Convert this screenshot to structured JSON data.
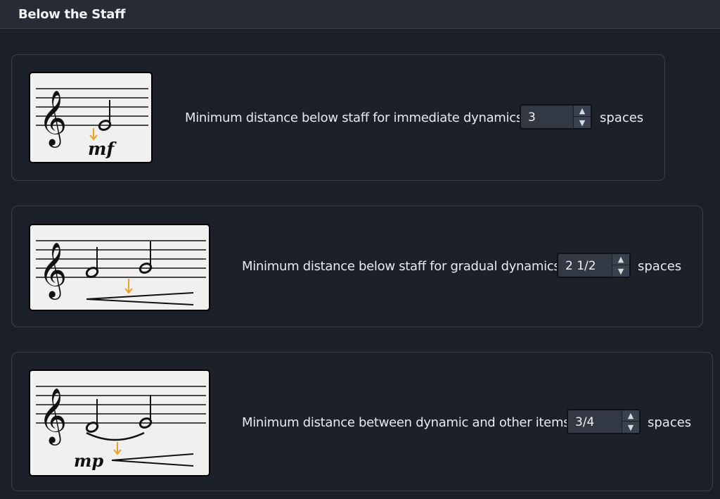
{
  "header": {
    "title": "Below the Staff"
  },
  "settings": [
    {
      "label": "Minimum distance below staff for immediate dynamics:",
      "value": "3",
      "unit": "spaces",
      "dynamic_text": "mf"
    },
    {
      "label": "Minimum distance below staff for gradual dynamics:",
      "value": "2 1/2",
      "unit": "spaces"
    },
    {
      "label": "Minimum distance between dynamic and other items:",
      "value": "3/4",
      "unit": "spaces",
      "dynamic_text": "mp"
    }
  ],
  "icons": {
    "up": "chevron-up-icon",
    "down": "chevron-down-icon",
    "arrow_color": "#f0a020"
  }
}
